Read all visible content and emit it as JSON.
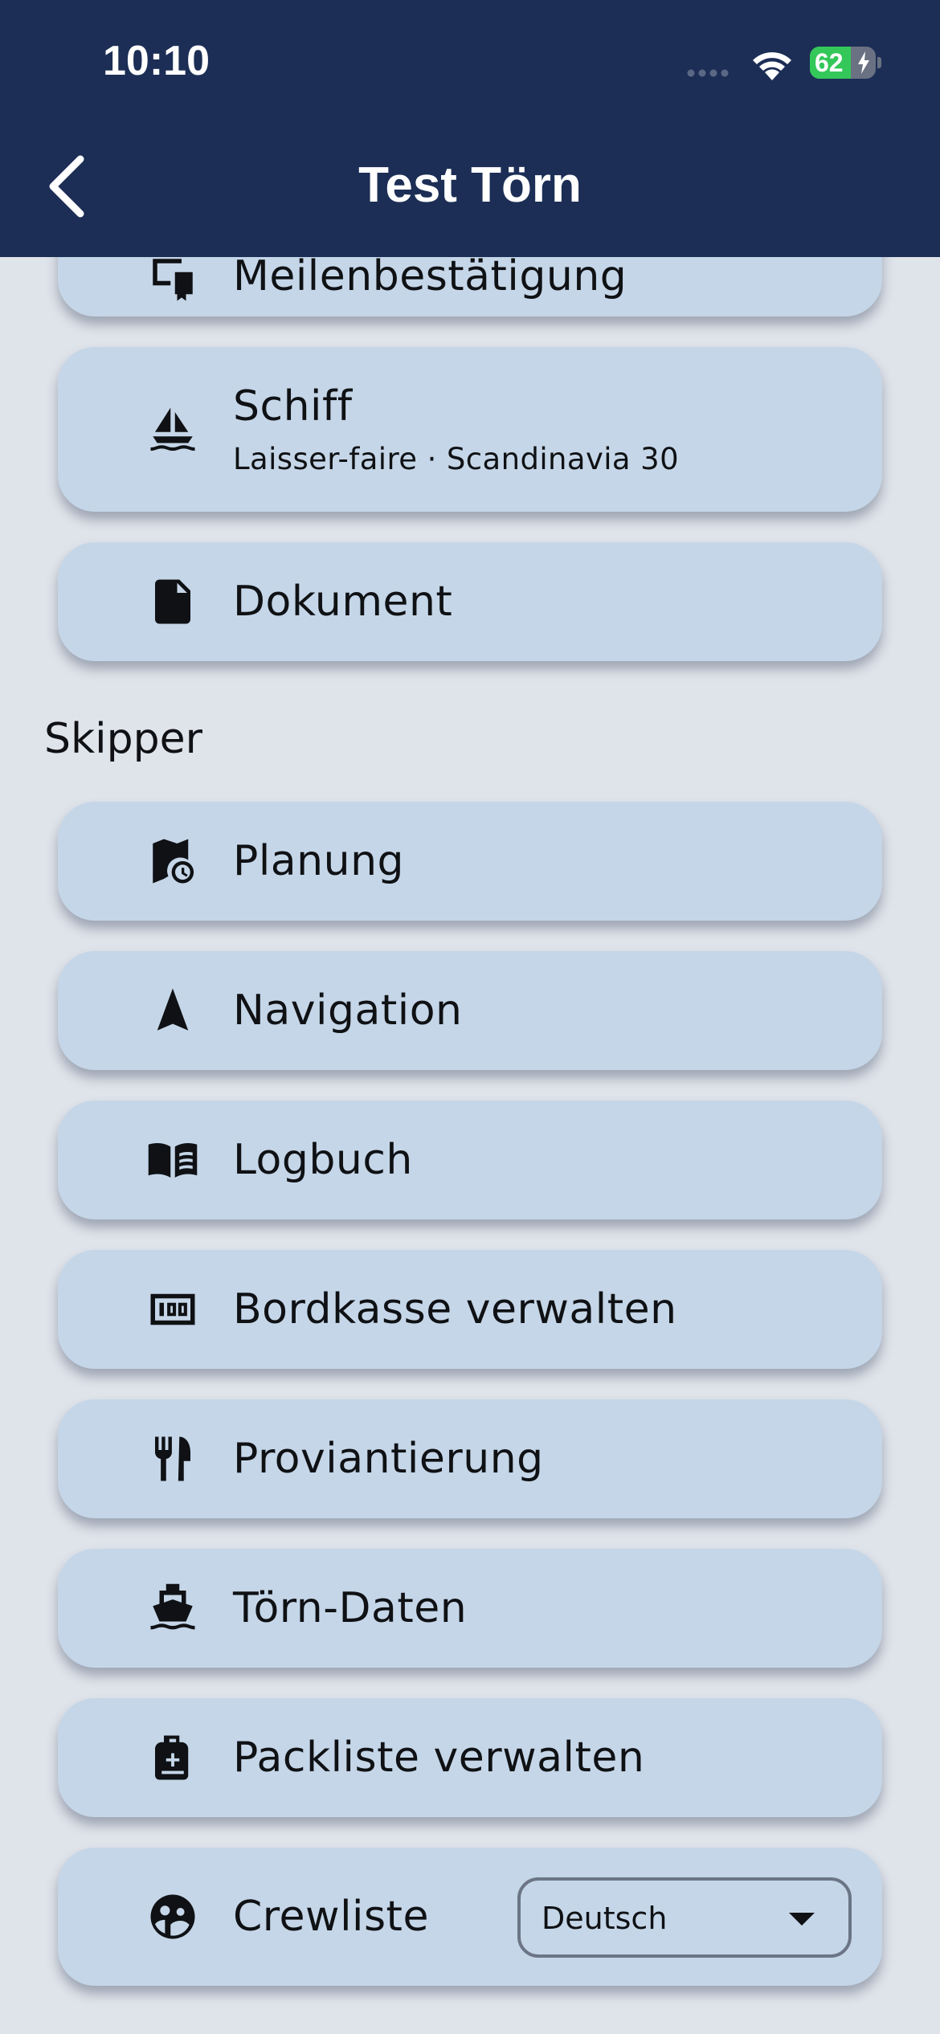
{
  "status_bar": {
    "time": "10:10",
    "battery": "62"
  },
  "header": {
    "title": "Test Törn"
  },
  "cards_top": {
    "partial_label": "Meilenbestätigung",
    "ship": {
      "title": "Schiff",
      "subtitle": "Laisser-faire · Scandinavia 30"
    },
    "document": {
      "title": "Dokument"
    }
  },
  "skipper": {
    "section_title": "Skipper",
    "items": [
      {
        "label": "Planung",
        "icon": "map-clock-icon"
      },
      {
        "label": "Navigation",
        "icon": "navigation-arrow-icon"
      },
      {
        "label": "Logbuch",
        "icon": "book-icon"
      },
      {
        "label": "Bordkasse verwalten",
        "icon": "cash-icon"
      },
      {
        "label": "Proviantierung",
        "icon": "cutlery-icon"
      },
      {
        "label": "Törn-Daten",
        "icon": "ferry-icon"
      },
      {
        "label": "Packliste verwalten",
        "icon": "backpack-icon"
      }
    ],
    "crew": {
      "label": "Crewliste",
      "language_select": "Deutsch"
    }
  },
  "colors": {
    "header": "#1c2e55",
    "background": "#dfe3ea",
    "card": "#c5d6e8",
    "battery": "#34c759"
  }
}
